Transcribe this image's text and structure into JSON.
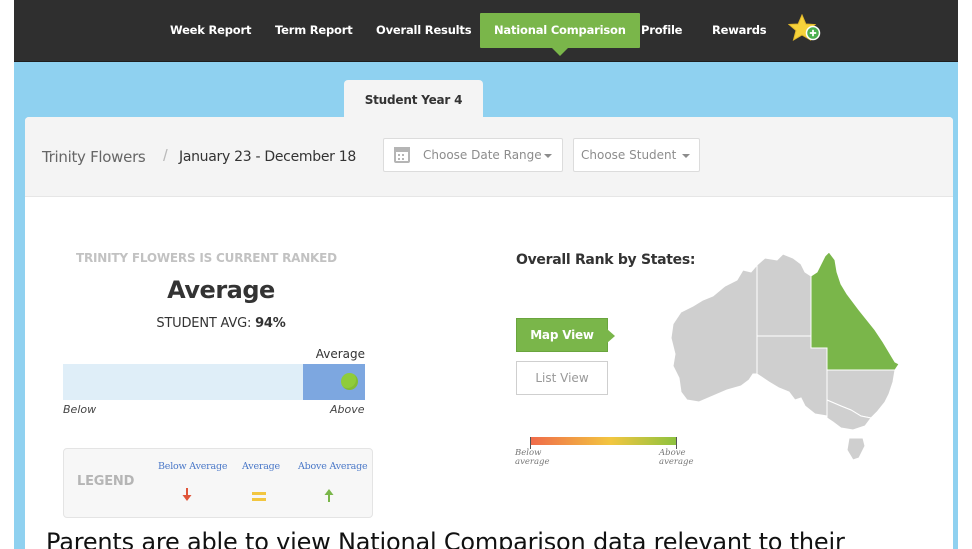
{
  "nav": {
    "items": [
      {
        "label": "Week Report"
      },
      {
        "label": "Term Report"
      },
      {
        "label": "Overall Results"
      },
      {
        "label": "National Comparison",
        "active": true
      },
      {
        "label": "Profile"
      },
      {
        "label": "Rewards"
      }
    ],
    "rewards_icon": "star-plus-icon"
  },
  "tab": {
    "label": "Student Year 4"
  },
  "header": {
    "student_name": "Trinity Flowers",
    "separator": "/",
    "date_range": "January 23 - December 18",
    "date_dropdown": {
      "label": "Choose Date Range",
      "icon": "calendar-icon"
    },
    "student_dropdown": {
      "label": "Choose Student"
    }
  },
  "ranking": {
    "intro": "TRINITY FLOWERS IS CURRENT RANKED",
    "rank": "Average",
    "avg_label": "STUDENT AVG:",
    "avg_value": "94%",
    "bar_label": "Average",
    "below_label": "Below",
    "above_label": "Above",
    "position_fraction": 0.94
  },
  "legend": {
    "title": "LEGEND",
    "items": [
      {
        "label": "Below Average",
        "icon": "down-arrow-icon",
        "color": "#e0553a"
      },
      {
        "label": "Average",
        "icon": "equals-icon",
        "color": "#f2c640"
      },
      {
        "label": "Above Average",
        "icon": "up-arrow-icon",
        "color": "#7ab64a"
      }
    ]
  },
  "map_panel": {
    "title": "Overall Rank by States:",
    "map_view_label": "Map View",
    "list_view_label": "List View",
    "scale_low": "Below average",
    "scale_low_1": "Below",
    "scale_low_2": "average",
    "scale_high_1": "Above",
    "scale_high_2": "average",
    "highlight_color": "#7ab64a",
    "base_color": "#cfcfcf"
  },
  "caption": "Parents are able to view National Comparison data relevant to their"
}
